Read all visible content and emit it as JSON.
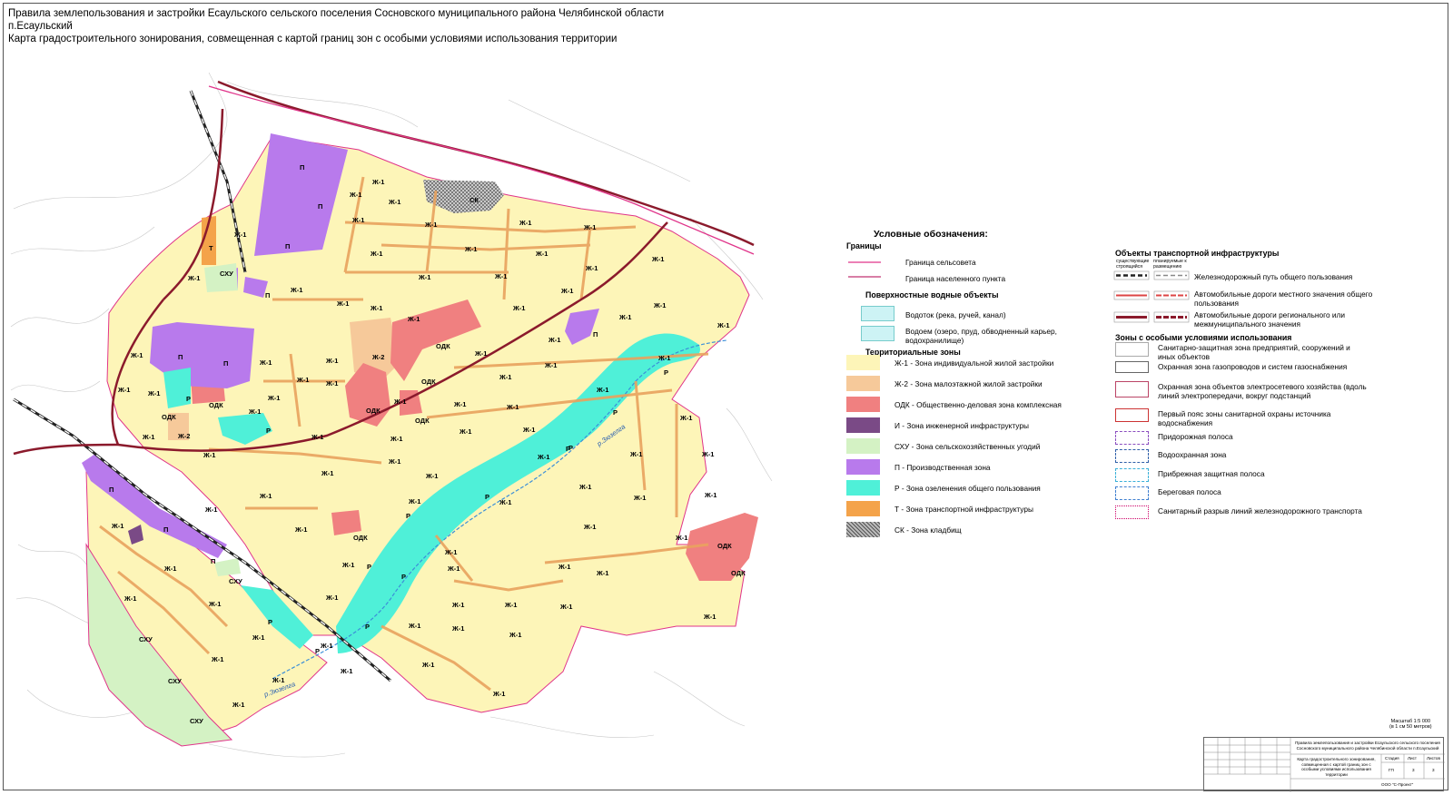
{
  "header": {
    "line1": "Правила землепользования и застройки Есаульского сельского поселения Сосновского муниципального района Челябинской области",
    "line2": "п.Есаульский",
    "line3": "Карта градостроительного зонирования, совмещенная с картой границ зон с особыми условиями использования территории"
  },
  "map_labels": {
    "zh1": "Ж-1",
    "zh2": "Ж-2",
    "odk": "ОДК",
    "p": "П",
    "r": "Р",
    "t": "Т",
    "ck": "СК",
    "cxu": "СХУ",
    "river": "р.Зюзелга"
  },
  "legend": {
    "title": "Условные обозначения:",
    "boundaries": {
      "heading": "Границы",
      "items": [
        "Граница сельсовета",
        "Граница населенного пункта"
      ]
    },
    "water": {
      "heading": "Поверхностные водные объекты",
      "items": [
        "Водоток (река, ручей, канал)",
        "Водоем (озеро, пруд, обводненный карьер, водохранилище)"
      ]
    },
    "zones": {
      "heading": "Территориальные зоны",
      "items": [
        "Ж-1 - Зона индивидуальной жилой застройки",
        "Ж-2 - Зона малоэтажной жилой застройки",
        "ОДК - Общественно-деловая зона комплексная",
        "И - Зона инженерной инфраструктуры",
        "СХУ - Зона сельскохозяйственных угодий",
        "П - Производственная зона",
        "Р - Зона озеленения общего пользования",
        "Т - Зона транспортной инфраструктуры",
        "СК - Зона кладбищ"
      ]
    },
    "transport": {
      "heading": "Объекты транспортной инфраструктуры",
      "existing": "существующие строящийся",
      "planned": "планируемые к размещению",
      "items": [
        "Железнодорожный путь общего пользования",
        "Автомобильные дороги местного значения общего пользования",
        "Автомобильные дороги регионального или межмуниципального значения"
      ]
    },
    "special": {
      "heading": "Зоны с особыми условиями использования",
      "items": [
        "Санитарно-защитная зона предприятий, сооружений и иных объектов",
        "Охранная зона газопроводов и систем газоснабжения",
        "Охранная зона объектов электросетевого хозяйства (вдоль линий электропередачи, вокруг подстанций",
        "Первый пояс зоны санитарной охраны источника водоснабжения",
        "Придорожная полоса",
        "Водоохранная зона",
        "Прибрежная защитная полоса",
        "Береговая полоса",
        "Санитарный разрыв линий железнодорожного транспорта"
      ]
    }
  },
  "scale": {
    "line1": "Масштаб 1:5 000",
    "line2": "(в 1 см 50 метров)"
  },
  "stamp": {
    "project": "Правила землепользования и застройки Есаульского сельского поселения Сосновского муниципального района Челябинской области п.Есаульский",
    "sheet_title": "Карта градостроительного зонирования, совмещенная с картой границ зон с особыми условиями использования территории",
    "stage_label": "Стадия",
    "sheet_label": "Лист",
    "sheets_label": "Листов",
    "stage": "ГП",
    "sheet": "3",
    "sheets": "3",
    "company": "ООО \"С-Проект\""
  },
  "colors": {
    "zh1": "#fdf5b8",
    "zh2": "#f6c99a",
    "odk": "#f08080",
    "inzh": "#7a4a86",
    "cxu": "#d4f2c4",
    "prom": "#b87aec",
    "rec": "#4ff0d8",
    "trans": "#f4a34a",
    "cem": "#8c8c8c",
    "water": "#cdf3f5",
    "road": "#e9a25e",
    "main_road": "#8b1a2c",
    "border": "#e0348a"
  }
}
